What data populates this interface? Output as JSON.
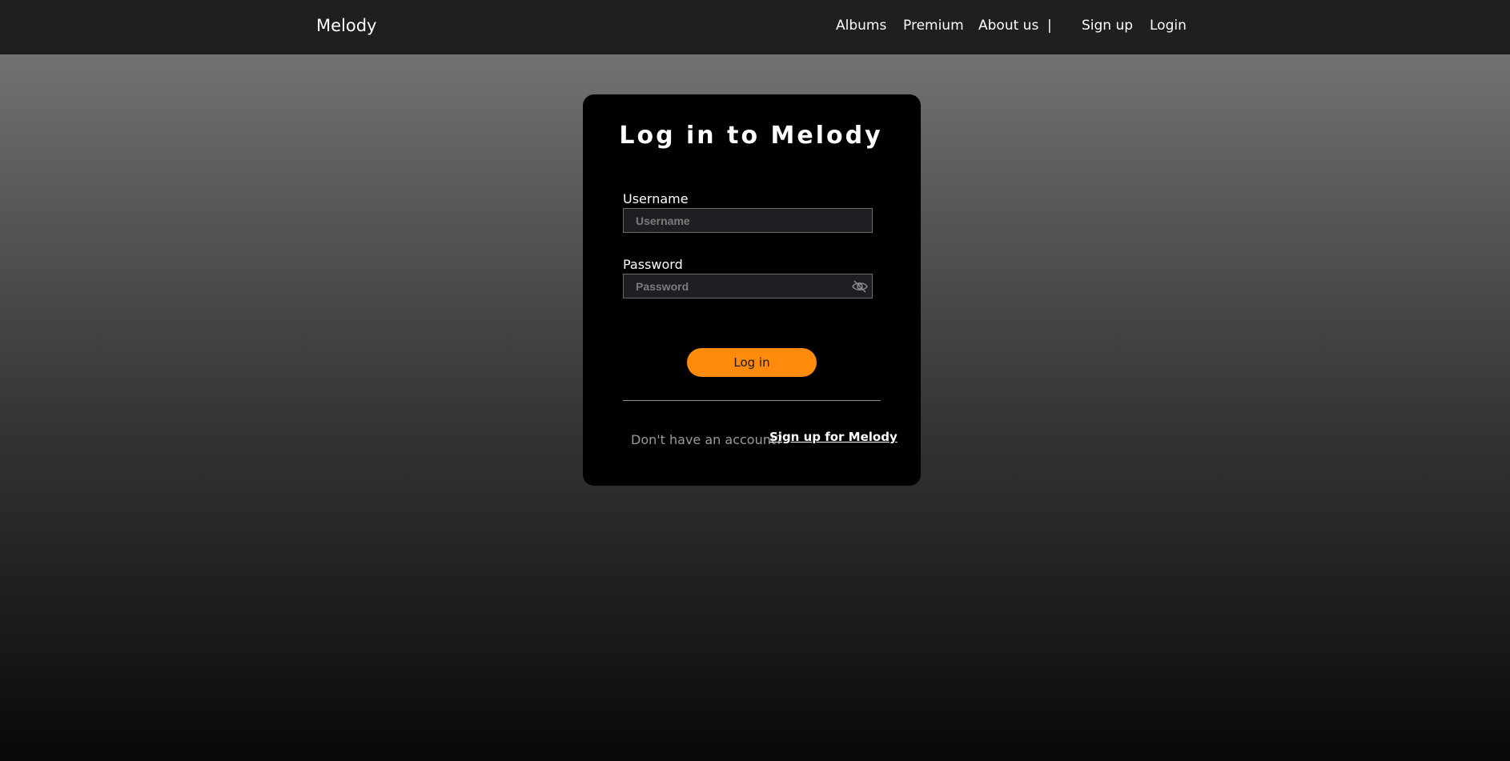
{
  "header": {
    "brand": "Melody",
    "nav": {
      "albums": "Albums",
      "premium": "Premium",
      "about": "About us",
      "separator": "|",
      "signup": "Sign up",
      "login": "Login"
    }
  },
  "login_card": {
    "title": "Log in to Melody",
    "username": {
      "label": "Username",
      "placeholder": "Username",
      "value": ""
    },
    "password": {
      "label": "Password",
      "placeholder": "Password",
      "value": "",
      "toggle_icon": "eye-slash-icon"
    },
    "submit_label": "Log in",
    "signup_prompt": "Don't have an account?",
    "signup_link": "Sign up for Melody"
  },
  "colors": {
    "navbar_bg": "#1f1f1f",
    "card_bg": "#000000",
    "accent": "#ff8a0b",
    "field_bg": "#1e1f22",
    "muted_text": "#9a9a9a"
  }
}
